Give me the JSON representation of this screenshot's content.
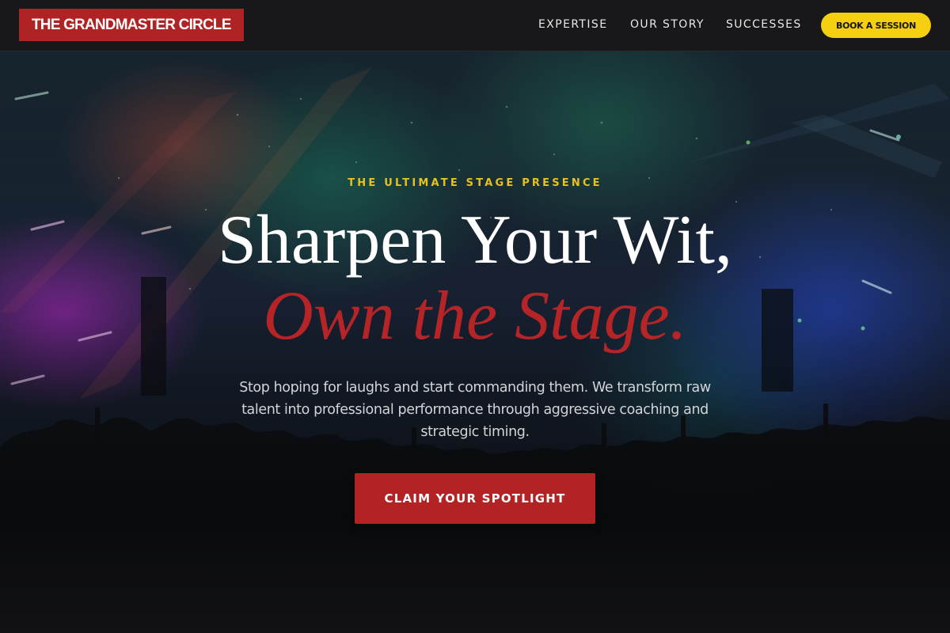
{
  "header": {
    "logo_text": "THE GRANDMASTER CIRCLE",
    "nav": [
      {
        "label": "EXPERTISE"
      },
      {
        "label": "OUR STORY"
      },
      {
        "label": "SUCCESSES"
      }
    ],
    "cta_label": "BOOK A SESSION"
  },
  "hero": {
    "eyebrow": "THE ULTIMATE STAGE PRESENCE",
    "headline_line1": "Sharpen Your Wit,",
    "headline_line2": "Own the Stage.",
    "subtext": "Stop hoping for laughs and start commanding them. We transform raw talent into professional performance through aggressive coaching and strategic timing.",
    "cta_label": "CLAIM YOUR SPOTLIGHT",
    "background_image": "concert-crowd-stage-lights"
  },
  "colors": {
    "brand_red": "#b02324",
    "accent_yellow": "#f5cf10",
    "eyebrow_gold": "#e7c21c",
    "header_bg": "#18181a"
  }
}
